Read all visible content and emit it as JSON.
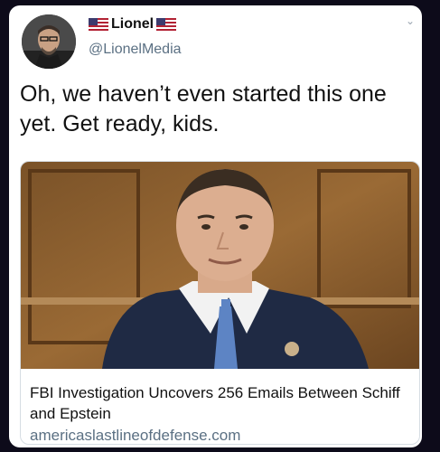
{
  "tweet": {
    "display_name": "Lionel",
    "handle": "@LionelMedia",
    "text": "Oh, we haven’t even started this one yet. Get ready, kids."
  },
  "link_card": {
    "headline": "FBI Investigation Uncovers 256 Emails Between Schiff and Epstein",
    "domain": "americaslastlineofdefense.com"
  },
  "icons": {
    "flag": "us-flag-icon",
    "menu": "chevron-down-icon"
  },
  "colors": {
    "page_bg": "#0d0b1a",
    "card_bg": "#ffffff",
    "secondary_text": "#5b7083"
  }
}
